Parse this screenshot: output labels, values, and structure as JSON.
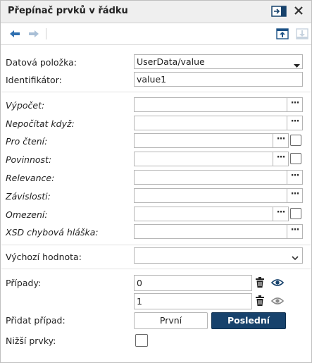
{
  "panel": {
    "title": "Přepínač prvků v řádku",
    "accent_color": "#17426c"
  },
  "toolbar": {
    "icons": [
      "arrow-left-icon",
      "arrow-right-icon",
      "move-up-icon",
      "move-down-icon"
    ]
  },
  "fields": {
    "data_item": {
      "label": "Datová položka:",
      "value": "UserData/value"
    },
    "identifier": {
      "label": "Identifikátor:",
      "value": "value1"
    },
    "calculation": {
      "label": "Výpočet:",
      "dots": "···"
    },
    "dont_calc": {
      "label": "Nepočítat když:",
      "dots": "···"
    },
    "readonly": {
      "label": "Pro čtení:",
      "dots": "···"
    },
    "required": {
      "label": "Povinnost:",
      "dots": "···"
    },
    "relevance": {
      "label": "Relevance:",
      "dots": "···"
    },
    "dependencies": {
      "label": "Závislosti:",
      "dots": "···"
    },
    "constraint": {
      "label": "Omezení:",
      "dots": "···"
    },
    "xsd_error": {
      "label": "XSD chybová hláška:",
      "dots": "···"
    },
    "default_value": {
      "label": "Výchozí hodnota:",
      "value": ""
    }
  },
  "cases": {
    "label": "Případy:",
    "items": [
      {
        "value": "0"
      },
      {
        "value": "1"
      }
    ]
  },
  "add_case": {
    "label": "Přidat případ:",
    "first_label": "První",
    "last_label": "Poslední"
  },
  "lower_items": {
    "label": "Nižší prvky:",
    "checked": false
  }
}
